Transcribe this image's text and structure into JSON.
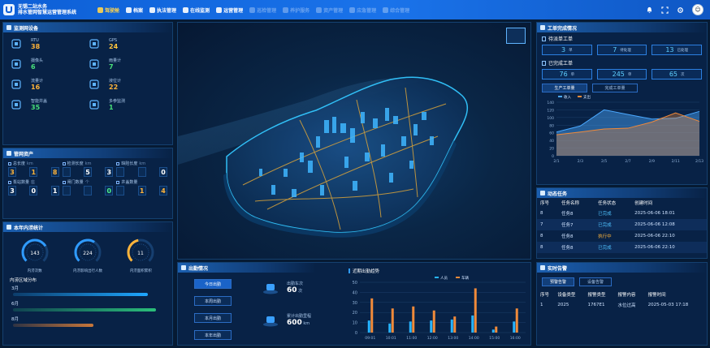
{
  "header": {
    "brand_line1": "无锡二站水务",
    "brand_line2": "排水管网智慧运营管理系统",
    "nav": [
      {
        "label": "驾驶舱",
        "state": "active"
      },
      {
        "label": "档案",
        "state": "normal"
      },
      {
        "label": "执法管理",
        "state": "normal"
      },
      {
        "label": "在线监测",
        "state": "normal"
      },
      {
        "label": "运营管理",
        "state": "normal"
      },
      {
        "label": "巡检管理",
        "state": "dim"
      },
      {
        "label": "养护服务",
        "state": "dim"
      },
      {
        "label": "资产管理",
        "state": "dim"
      },
      {
        "label": "应急管理",
        "state": "dim"
      },
      {
        "label": "综合管理",
        "state": "dim"
      }
    ]
  },
  "monitor": {
    "title": "监测网设备",
    "items": [
      {
        "icon": "rtu-icon",
        "label": "RTU",
        "value": "38",
        "tone": "o"
      },
      {
        "icon": "gps-icon",
        "label": "GPS",
        "value": "24",
        "tone": "y"
      },
      {
        "icon": "camera-icon",
        "label": "摄像头",
        "value": "6",
        "tone": "g"
      },
      {
        "icon": "drop-icon",
        "label": "雨量计",
        "value": "7",
        "tone": "g"
      },
      {
        "icon": "meter-icon",
        "label": "流量计",
        "value": "16",
        "tone": "o"
      },
      {
        "icon": "level-icon",
        "label": "液位计",
        "value": "22",
        "tone": "o"
      },
      {
        "icon": "gate-icon",
        "label": "智能井盖",
        "value": "35",
        "tone": "g"
      },
      {
        "icon": "param-icon",
        "label": "多参监测",
        "value": "1",
        "tone": "g"
      }
    ]
  },
  "assets": {
    "title": "管网资产",
    "rows": [
      [
        {
          "label": "总长度",
          "unit": "km",
          "digits": [
            "3",
            "1",
            "8"
          ],
          "tone": "o"
        },
        {
          "label": "检测长度",
          "unit": "km",
          "digits": [
            "",
            "5",
            "3"
          ],
          "tone": "w"
        },
        {
          "label": "缺陷长度",
          "unit": "km",
          "digits": [
            "",
            "",
            "0"
          ],
          "tone": "w"
        }
      ],
      [
        {
          "label": "泵站数量",
          "unit": "座",
          "digits": [
            "3",
            "0",
            "1"
          ],
          "tone": "w"
        },
        {
          "label": "闸门数量",
          "unit": "个",
          "digits": [
            "",
            "",
            "0"
          ],
          "tone": "g"
        },
        {
          "label": "井盖数量",
          "unit": "",
          "digits": [
            "",
            "1",
            "4"
          ],
          "tone": "o"
        }
      ]
    ]
  },
  "year": {
    "title": "本年内涝统计",
    "gauges": [
      {
        "value": "143",
        "label": "内涝次数",
        "pct": 0.72,
        "color": "#2f9bff"
      },
      {
        "value": "224",
        "label": "内涝影响出行人数",
        "pct": 0.62,
        "color": "#2f9bff"
      },
      {
        "value": "11",
        "label": "内涝面积累积",
        "pct": 0.46,
        "color": "#ffb43a"
      }
    ],
    "sub_title": "内涝区域分布",
    "bars": [
      {
        "label": "3月",
        "pct": 0.92,
        "color": "#1ea7ff"
      },
      {
        "label": "6月",
        "pct": 0.98,
        "color": "#2bbf7a"
      },
      {
        "label": "8月",
        "pct": 0.55,
        "color": "#c9773a"
      }
    ]
  },
  "dispatch": {
    "title": "出勤情况",
    "buttons": [
      "今日出勤",
      "本周出勤",
      "本月出勤",
      "本年出勤"
    ],
    "kpis": [
      {
        "icon": "car-icon",
        "label": "出勤车次",
        "value": "60",
        "unit": "次"
      },
      {
        "icon": "person-icon",
        "label": "累计出勤里程",
        "value": "600",
        "unit": "km"
      }
    ]
  },
  "trend": {
    "title": "近期出勤趋势",
    "legend": [
      "人员",
      "车辆"
    ],
    "colors": [
      "#27b4ff",
      "#f08a3a"
    ]
  },
  "chart_data": [
    {
      "type": "area",
      "legend": [
        "收入",
        "支出"
      ],
      "categories": [
        "2/1",
        "2/3",
        "2/5",
        "2/7",
        "2/9",
        "2/11",
        "2/13"
      ],
      "series": [
        {
          "name": "收入",
          "values": [
            62,
            78,
            120,
            108,
            96,
            98,
            116
          ]
        },
        {
          "name": "支出",
          "values": [
            55,
            62,
            70,
            72,
            88,
            112,
            90
          ]
        }
      ],
      "ylim": [
        0,
        140
      ],
      "yticks": [
        0,
        20,
        40,
        60,
        80,
        100,
        120,
        140
      ]
    },
    {
      "type": "bar",
      "categories": [
        "09:01",
        "10:01",
        "11:00",
        "12:00",
        "13:00",
        "14:00",
        "15:00",
        "16:00"
      ],
      "series": [
        {
          "name": "人员",
          "values": [
            12,
            9,
            11,
            12,
            13,
            17,
            3,
            11
          ]
        },
        {
          "name": "车辆",
          "values": [
            34,
            24,
            26,
            22,
            16,
            44,
            6,
            24
          ]
        }
      ],
      "ylim": [
        0,
        50
      ],
      "yticks": [
        0,
        10,
        20,
        30,
        40,
        50
      ]
    }
  ],
  "workorder": {
    "title": "工单完成情况",
    "group1": "待派单工单",
    "cards1": [
      {
        "value": "3",
        "unit": "单"
      },
      {
        "value": "7",
        "unit": "待处理"
      },
      {
        "value": "13",
        "unit": "已处理"
      }
    ],
    "group2": "已完成工单",
    "cards2": [
      {
        "value": "76",
        "unit": "单"
      },
      {
        "value": "245",
        "unit": "单"
      },
      {
        "value": "65",
        "unit": "次"
      }
    ],
    "tabs": [
      "生产工单量",
      "完成工单量"
    ]
  },
  "tasks": {
    "title": "动态任务",
    "headers": [
      "序号",
      "任务名称",
      "任务状态",
      "创建时间"
    ],
    "rows": [
      [
        "8",
        "任务8",
        "已完成",
        "2025-06-06 18:01"
      ],
      [
        "7",
        "任务7",
        "已完成",
        "2025-06-06 12:08"
      ],
      [
        "8",
        "任务8",
        "执行中",
        "2025-06-06 22:10"
      ],
      [
        "8",
        "任务8",
        "已完成",
        "2025-06-06 22:10"
      ]
    ]
  },
  "alarm": {
    "title": "实时告警",
    "tabs": [
      "预警告警",
      "设备告警"
    ],
    "headers": [
      "序号",
      "设备类型",
      "报警类型",
      "报警内容",
      "报警时间"
    ],
    "rows": [
      [
        "1",
        "2025",
        "1767E1",
        "水位过高",
        "2025-05-03 17:18"
      ]
    ]
  }
}
